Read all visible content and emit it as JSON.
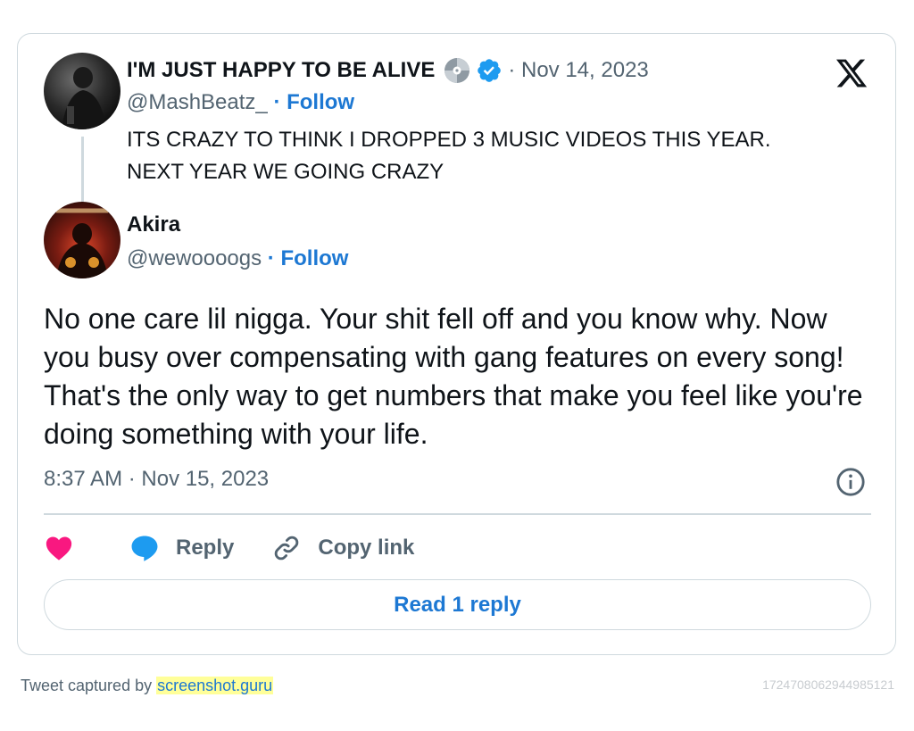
{
  "quoted": {
    "name": "I'M JUST HAPPY TO BE ALIVE",
    "date": "· Nov 14, 2023",
    "handle": "@MashBeatz_",
    "follow": "· Follow",
    "text_line1": "ITS CRAZY TO THINK I DROPPED 3 MUSIC VIDEOS THIS YEAR.",
    "text_line2": "NEXT YEAR WE GOING CRAZY",
    "icons": [
      "avatar-photo",
      "disc-icon",
      "verified-badge-icon"
    ]
  },
  "reply": {
    "name": "Akira",
    "handle": "@wewoooogs",
    "follow": "· Follow",
    "text": "No one care lil nigga. Your shit fell off and you know why. Now you busy over compensating with gang features on every song! That's the only way to get numbers that make you feel like you're doing something with your life.",
    "timestamp": "8:37 AM · Nov 15, 2023"
  },
  "actions": {
    "reply_label": "Reply",
    "copy_label": "Copy link",
    "read_reply_label": "Read 1 reply"
  },
  "footer": {
    "captured_by": "Tweet captured by",
    "site": "screenshot.guru",
    "tweet_id": "1724708062944985121"
  },
  "colors": {
    "accent": "#1d78d3",
    "verified": "#1d9bf0",
    "heart": "#f91880",
    "muted": "#536471",
    "border": "#cfd9de"
  }
}
